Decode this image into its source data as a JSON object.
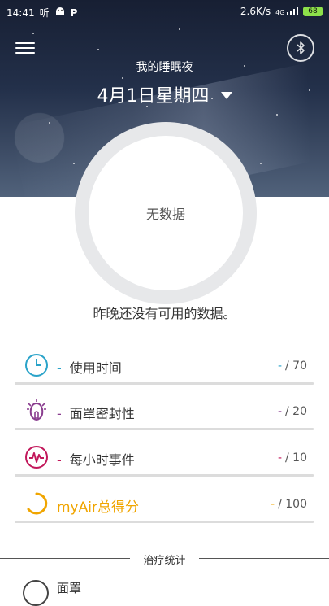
{
  "status_bar": {
    "time": "14:41",
    "carrier_glyph": "听",
    "net_speed": "2.6K/s",
    "signal": "4G",
    "battery": "68"
  },
  "header": {
    "subtitle": "我的睡眠夜",
    "date": "4月1日星期四"
  },
  "ring": {
    "text": "无数据"
  },
  "message": "昨晚还没有可用的数据。",
  "rows": [
    {
      "label": "使用时间",
      "current": "-",
      "max": "/ 70",
      "color": "#2aa3c9",
      "icon": "clock-icon"
    },
    {
      "label": "面罩密封性",
      "current": "-",
      "max": "/ 20",
      "color": "#8a3d8f",
      "icon": "mask-icon"
    },
    {
      "label": "每小时事件",
      "current": "-",
      "max": "/ 10",
      "color": "#c2185b",
      "icon": "events-icon"
    },
    {
      "label": "myAir总得分",
      "current": "-",
      "max": "/ 100",
      "color": "#f0a500",
      "icon": "score-icon"
    }
  ],
  "section_title": "治疗统计",
  "peek_text": "面罩"
}
